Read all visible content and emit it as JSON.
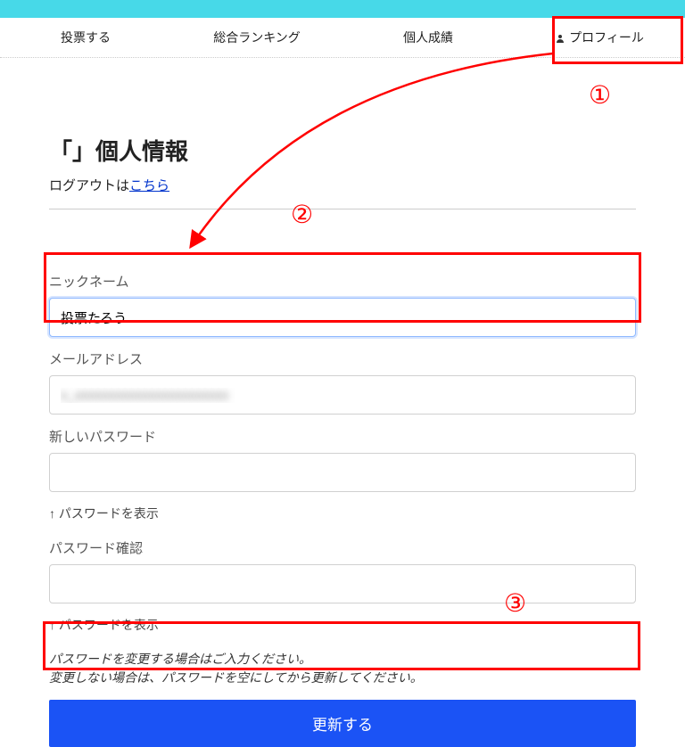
{
  "nav": {
    "vote": "投票する",
    "ranking": "総合ランキング",
    "results": "個人成績",
    "profile": "プロフィール"
  },
  "page": {
    "title": "「」個人情報",
    "logout_prefix": "ログアウトは",
    "logout_link": "こちら"
  },
  "form": {
    "nickname_label": "ニックネーム",
    "nickname_value": "投票たろう",
    "email_label": "メールアドレス",
    "email_value": "x_xxxxxxxxxxxxxxxxxxxxxxx",
    "newpw_label": "新しいパスワード",
    "pwconfirm_label": "パスワード確認",
    "show_pw": "↑ パスワードを表示",
    "note_line1": "パスワードを変更する場合はご入力ください。",
    "note_line2": "変更しない場合は、パスワードを空にしてから更新してください。",
    "submit": "更新する"
  },
  "annotations": {
    "n1": "①",
    "n2": "②",
    "n3": "③"
  }
}
